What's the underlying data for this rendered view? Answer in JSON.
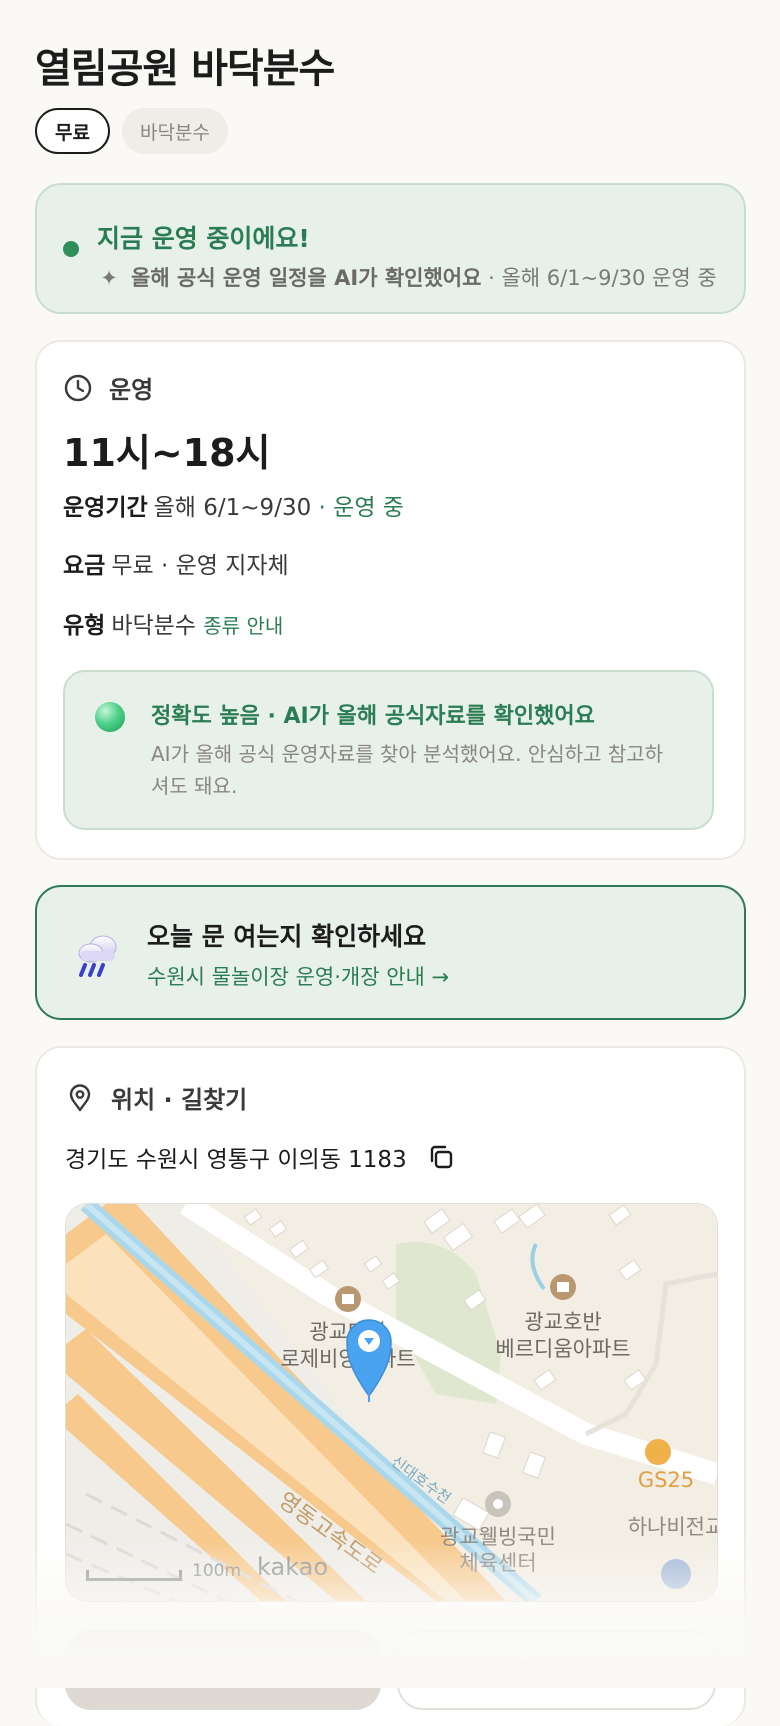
{
  "header": {
    "title": "열림공원 바닥분수",
    "chips": [
      "무료",
      "바닥분수"
    ]
  },
  "status": {
    "headline": "지금 운영 중이에요!",
    "ai_note": "올해 공식 운영 일정을 AI가 확인했어요",
    "period_note": "· 올해 6/1~9/30 운영 중"
  },
  "operation": {
    "section_title": "운영",
    "hours": "11시~18시",
    "period_label": "운영기간",
    "period_value": "올해 6/1~9/30",
    "period_status": "· 운영 중",
    "fee_label": "요금",
    "fee_value": "무료 · 운영 지자체",
    "type_label": "유형",
    "type_value": "바닥분수",
    "type_link": "종류 안내",
    "accuracy_title": "정확도 높음 · AI가 올해 공식자료를 확인했어요",
    "accuracy_desc": "AI가 올해 공식 운영자료를 찾아 분석했어요. 안심하고 참고하셔도 돼요."
  },
  "cta": {
    "icon": "rain-cloud-icon",
    "title": "오늘 문 여는지 확인하세요",
    "link": "수원시 물놀이장 운영·개장 안내 →"
  },
  "location": {
    "section_title": "위치 · 길찾기",
    "address": "경기도 수원시 영통구 이의동 1183",
    "map_labels": {
      "apt1_line1": "광교대광",
      "apt1_line2": "로제비앙아파트",
      "apt2_line1": "광교호반",
      "apt2_line2": "베르디움아파트",
      "stream": "신대호수천",
      "expressway": "영동고속도로",
      "store": "GS25",
      "center_line1": "광교웰빙국민",
      "center_line2": "체육센터",
      "edge": "하나비전교"
    },
    "scale": "100m",
    "map_brand": "kakao",
    "buttons": {
      "directions": "길찾기",
      "place": "플레이스"
    }
  },
  "colors": {
    "accent_green": "#2a7d52",
    "status_bg": "#e8f0ea",
    "pin_blue": "#4aa3f0"
  }
}
